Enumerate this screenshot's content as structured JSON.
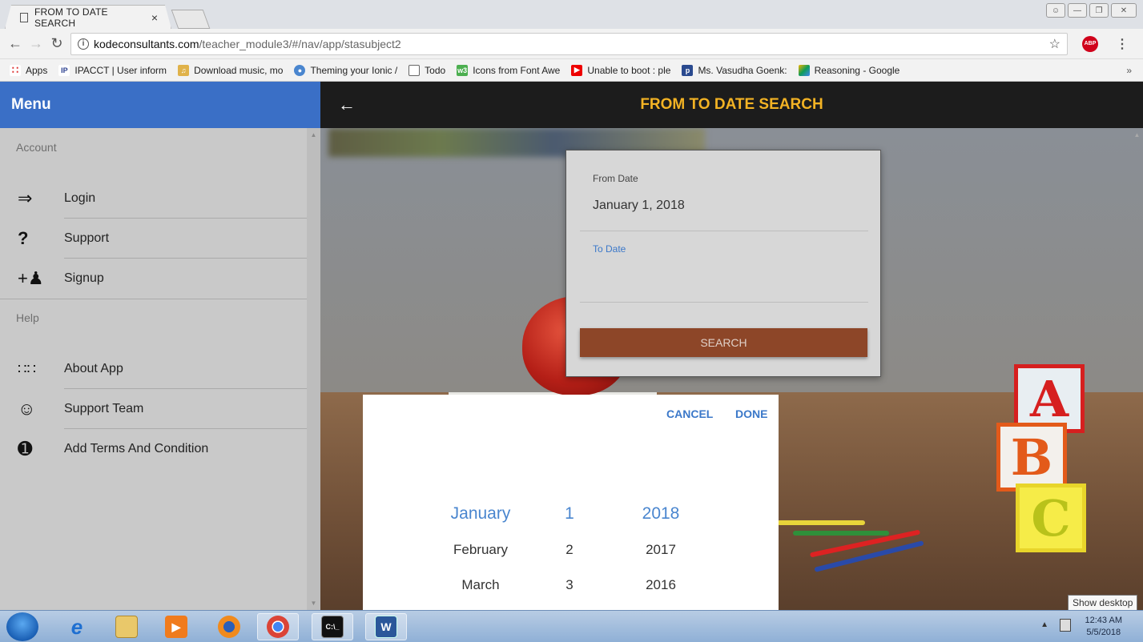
{
  "browser": {
    "tab_title": "FROM TO DATE SEARCH",
    "tab_close": "×",
    "url_host": "kodeconsultants.com",
    "url_path": "/teacher_module3/#/nav/app/stasubject2",
    "abp": "ABP",
    "bookmarks": [
      {
        "label": "Apps",
        "icon": "apps-grid-icon"
      },
      {
        "label": "IPACCT | User inform",
        "icon": "ip-logo-icon"
      },
      {
        "label": "Download music, mo",
        "icon": "music-icon"
      },
      {
        "label": "Theming your Ionic /",
        "icon": "chrome-icon"
      },
      {
        "label": "Todo",
        "icon": "page-icon"
      },
      {
        "label": "Icons from Font Awe",
        "icon": "w3-icon"
      },
      {
        "label": "Unable to boot : ple",
        "icon": "youtube-icon"
      },
      {
        "label": "Ms. Vasudha Goenk:",
        "icon": "p-icon"
      },
      {
        "label": "Reasoning - Google",
        "icon": "drive-icon"
      }
    ],
    "bookmarks_more": "»"
  },
  "menu": {
    "title": "Menu",
    "account_label": "Account",
    "help_label": "Help",
    "items": [
      {
        "label": "Login",
        "icon": "login-icon"
      },
      {
        "label": "Support",
        "icon": "question-icon"
      },
      {
        "label": "Signup",
        "icon": "add-person-icon"
      },
      {
        "label": "About App",
        "icon": "grid-icon"
      },
      {
        "label": "Support Team",
        "icon": "smiley-icon"
      },
      {
        "label": "Add Terms And Condition",
        "icon": "info-icon"
      }
    ]
  },
  "header": {
    "title": "FROM TO DATE SEARCH",
    "title_color": "#f3b324"
  },
  "form": {
    "from_label": "From Date",
    "from_value": "January 1, 2018",
    "to_label": "To Date",
    "to_value": "",
    "search_label": "SEARCH",
    "accent": "#3b78c9",
    "button_color": "#8d4628"
  },
  "picker": {
    "cancel_label": "CANCEL",
    "done_label": "DONE",
    "months": [
      "January",
      "February",
      "March"
    ],
    "days": [
      "1",
      "2",
      "3"
    ],
    "years": [
      "2018",
      "2017",
      "2016"
    ]
  },
  "taskbar": {
    "time": "12:43 AM",
    "date": "5/5/2018",
    "show_desktop": "Show desktop"
  }
}
